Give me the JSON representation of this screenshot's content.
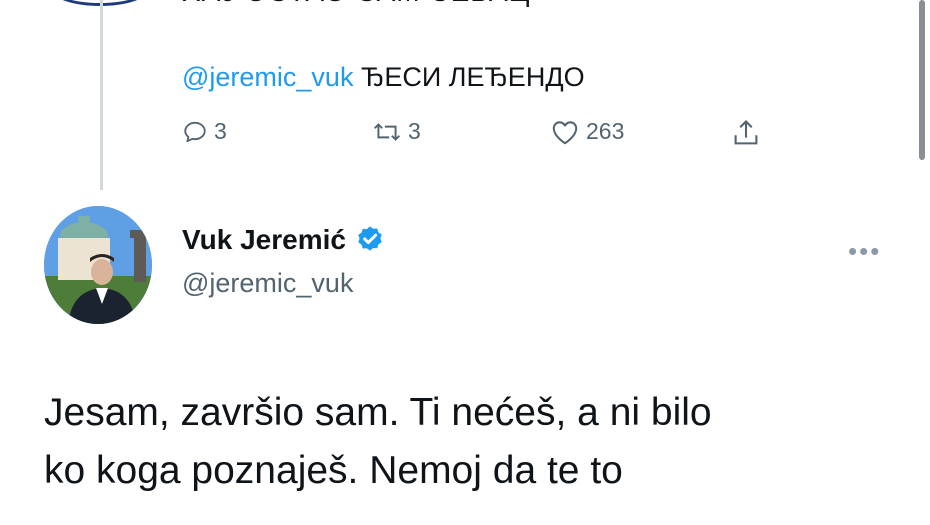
{
  "previous_tweet": {
    "cut_text": "ХАЈ ОСТАО САМ СЕБАЦ",
    "reply": {
      "mention": "@jeremic_vuk",
      "text": "ЂЕСИ ЛЕЂЕНДО"
    },
    "actions": {
      "replies": "3",
      "retweets": "3",
      "likes": "263"
    }
  },
  "tweet": {
    "author_name": "Vuk Jeremić",
    "author_handle": "@jeremic_vuk",
    "verified": true,
    "body": "Jesam, završio sam. Ti nećeš, a ni bilo\nko koga poznaješ. Nemoj da te to"
  },
  "colors": {
    "accent": "#1d9bf0",
    "muted": "#536471",
    "thread_line": "#cfd9de"
  },
  "icons": [
    "reply-icon",
    "retweet-icon",
    "like-icon",
    "share-icon",
    "verified-badge-icon",
    "more-options-icon"
  ]
}
